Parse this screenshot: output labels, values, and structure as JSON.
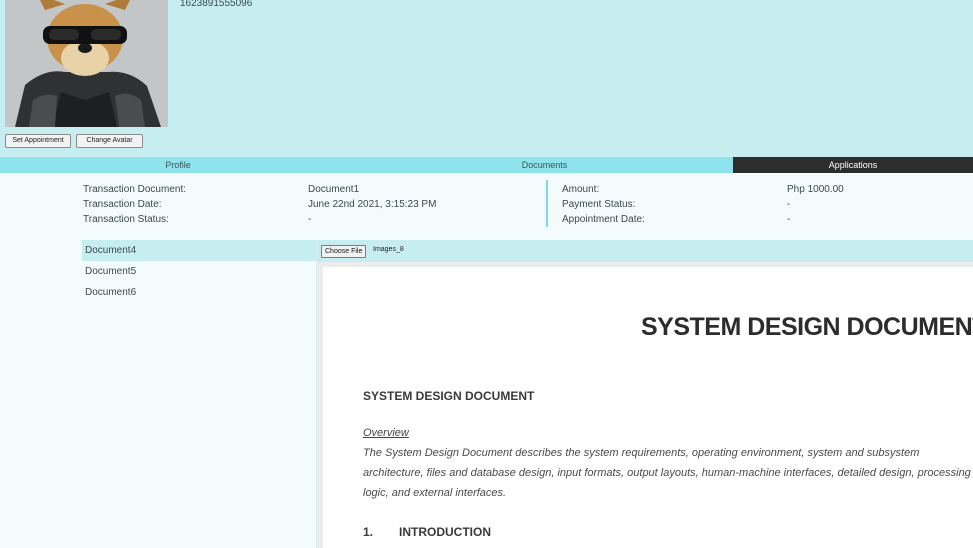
{
  "profile": {
    "phone": "1623891555096",
    "avatar_alt": "avatar",
    "set_appointment_label": "Set Appointment",
    "change_avatar_label": "Change Avatar"
  },
  "tabs": [
    {
      "label": "Profile"
    },
    {
      "label": "Documents"
    },
    {
      "label": "Applications"
    }
  ],
  "transaction": {
    "document_label": "Transaction Document:",
    "document_value": "Document1",
    "date_label": "Transaction Date:",
    "date_value": "June 22nd 2021, 3:15:23 PM",
    "status_label": "Transaction Status:",
    "status_value": "-",
    "amount_label": "Amount:",
    "amount_value": "Php 1000.00",
    "payment_label": "Payment Status:",
    "payment_value": "-",
    "appointment_label": "Appointment Date:",
    "appointment_value": "-"
  },
  "documents": [
    "Document4",
    "Document5",
    "Document6"
  ],
  "upload": {
    "choose_label": "Choose File",
    "file_name": "Images_8"
  },
  "preview": {
    "big_title": "SYSTEM DESIGN DOCUMENT",
    "heading": "SYSTEM DESIGN DOCUMENT",
    "overview_label": "Overview",
    "overview_text": "The System Design Document describes the system requirements, operating environment, system and subsystem architecture, files and database design, input formats, output layouts, human-machine interfaces, detailed design, processing logic, and external interfaces.",
    "section_number": "1.",
    "section_title": "INTRODUCTION"
  },
  "colors": {
    "header_bg": "#c6eef1",
    "tab_bg": "#8fe3ec",
    "tab_active_bg": "#2d2d2d"
  }
}
